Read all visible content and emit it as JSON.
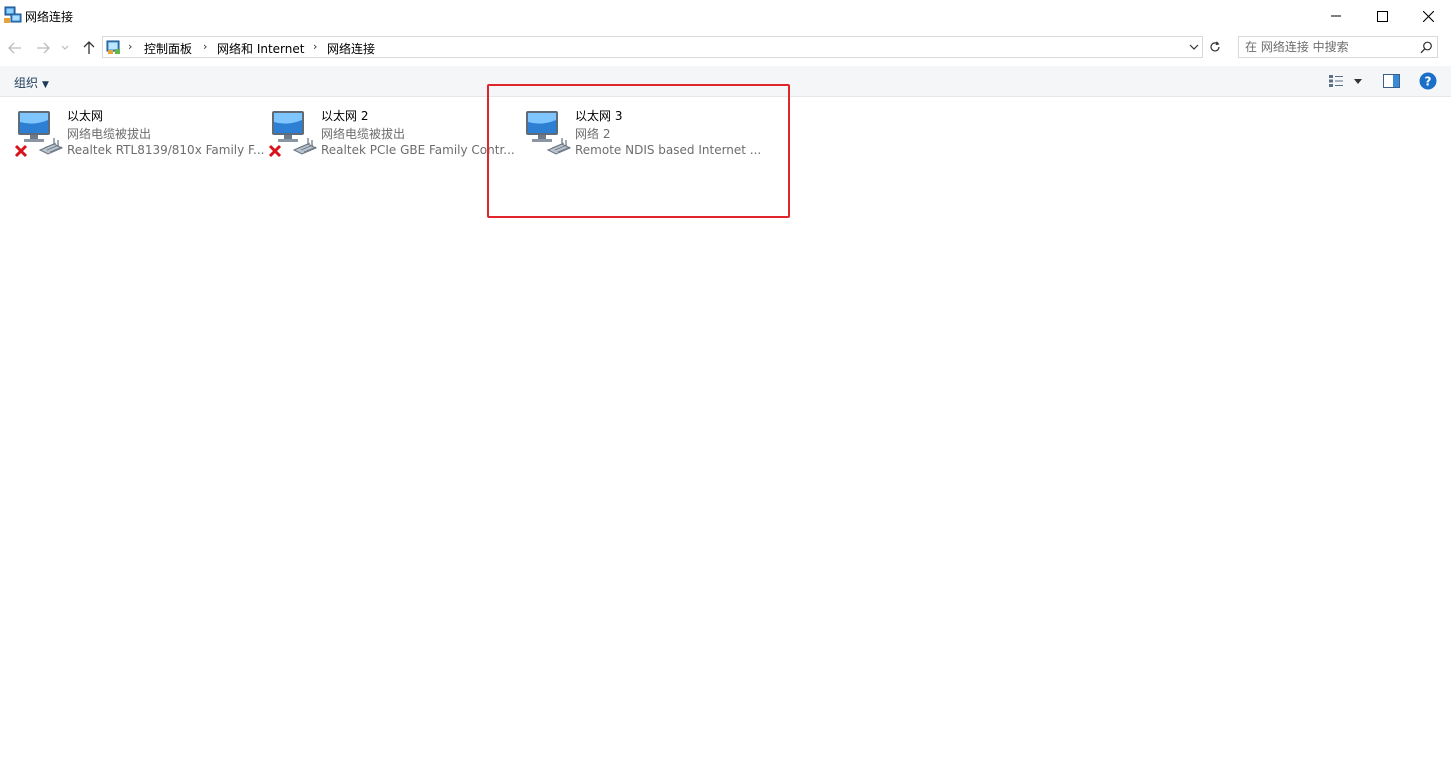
{
  "window": {
    "title": "网络连接"
  },
  "address": {
    "crumbs": [
      "控制面板",
      "网络和 Internet",
      "网络连接"
    ],
    "search_placeholder": "在 网络连接 中搜索"
  },
  "toolbar": {
    "organize_label": "组织",
    "organize_arrow": "▼"
  },
  "connections": [
    {
      "name": "以太网",
      "status": "网络电缆被拔出",
      "device": "Realtek RTL8139/810x Family F...",
      "disconnected": true
    },
    {
      "name": "以太网 2",
      "status": "网络电缆被拔出",
      "device": "Realtek PCIe GBE Family Contr...",
      "disconnected": true
    },
    {
      "name": "以太网 3",
      "status": "网络 2",
      "device": "Remote NDIS based Internet ...",
      "disconnected": false
    }
  ],
  "colors": {
    "highlight": "#e0262b",
    "help_blue": "#1a6fc9"
  }
}
